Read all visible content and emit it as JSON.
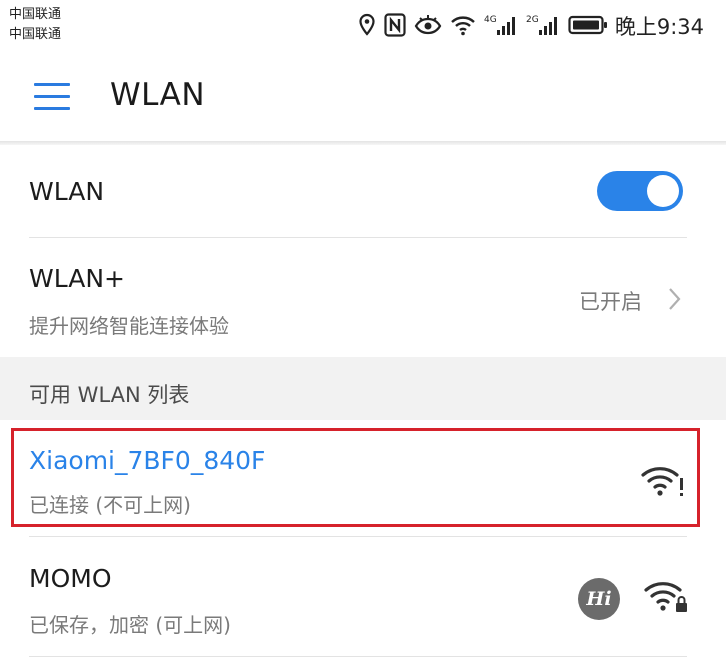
{
  "status_bar": {
    "carrier_1": "中国联通",
    "carrier_2": "中国联通",
    "signal_1_label": "4G",
    "signal_2_label": "2G",
    "time": "晚上9:34"
  },
  "header": {
    "title": "WLAN"
  },
  "wlan_switch": {
    "label": "WLAN",
    "enabled": true
  },
  "wlan_plus": {
    "title": "WLAN+",
    "subtitle": "提升网络智能连接体验",
    "status": "已开启"
  },
  "section": {
    "title": "可用 WLAN 列表"
  },
  "networks": [
    {
      "name": "Xiaomi_7BF0_840F",
      "status": "已连接 (不可上网)",
      "secured": false,
      "connected": true
    },
    {
      "name": "MOMO",
      "status": "已保存，加密 (可上网)",
      "secured": true,
      "hi_badge": "Hi"
    }
  ],
  "colors": {
    "accent": "#2a83e8",
    "highlight_border": "#d6222b",
    "section_bg": "#f2f2f2"
  }
}
